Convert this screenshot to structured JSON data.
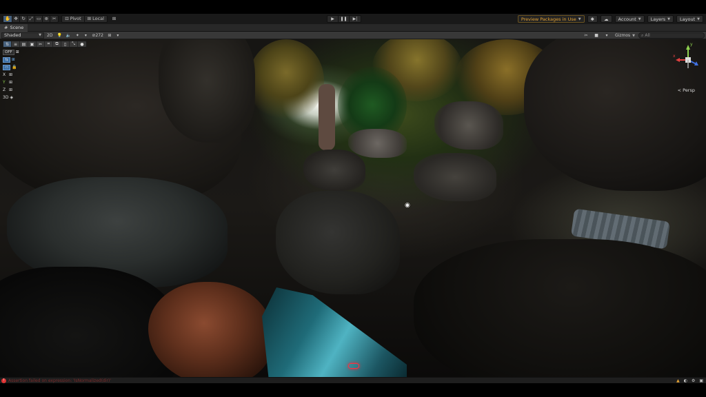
{
  "toolbar": {
    "tools": [
      {
        "icon": "hand-icon",
        "glyph": "✋"
      },
      {
        "icon": "move-icon",
        "glyph": "✥"
      },
      {
        "icon": "rotate-icon",
        "glyph": "↻"
      },
      {
        "icon": "scale-icon",
        "glyph": "⤢"
      },
      {
        "icon": "rect-icon",
        "glyph": "▭"
      },
      {
        "icon": "transform-icon",
        "glyph": "⊕"
      },
      {
        "icon": "custom-tool-icon",
        "glyph": "✂"
      }
    ],
    "pivot_label": "Pivot",
    "local_label": "Local",
    "grid_snap_glyph": "⊞",
    "play_glyph": "▶",
    "pause_glyph": "❚❚",
    "step_glyph": "▶|",
    "preview_packages_label": "Preview Packages in Use",
    "account_label": "Account",
    "layers_label": "Layers",
    "layout_label": "Layout"
  },
  "tabs": {
    "scene_label": "Scene",
    "scene_icon": "scene-icon"
  },
  "scenebar": {
    "draw_mode": "Shaded",
    "mode_2d": "2D",
    "hidden_count": "272",
    "gizmos_label": "Gizmos",
    "search_placeholder": "All"
  },
  "overlay": {
    "off_label": "OFF",
    "x_label": "X",
    "y_label": "Y",
    "z_label": "Z",
    "mode_3d_label": "3D"
  },
  "viewport": {
    "persp_label": "Persp",
    "gizmo_y": "y",
    "gizmo_x": "x"
  },
  "status": {
    "error_text": "Assertion failed on expression: 'IsNormalized(dir)'"
  },
  "colors": {
    "accent_blue": "#46607c",
    "preview_orange": "#e5a334",
    "error_red": "#d33333"
  }
}
